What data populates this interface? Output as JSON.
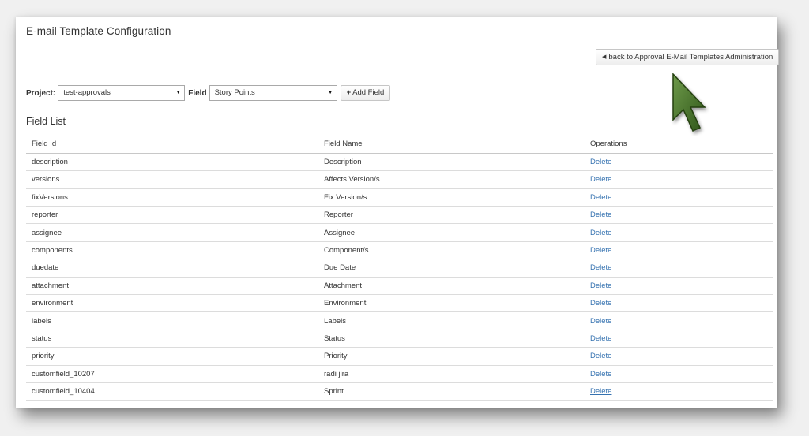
{
  "page": {
    "title": "E-mail Template Configuration"
  },
  "back_button": {
    "label": "back to Approval E-Mail Templates Administration"
  },
  "toolbar": {
    "project_label": "Project:",
    "project_value": "test-approvals",
    "field_label": "Field",
    "field_value": "Story Points",
    "add_button": "Add Field"
  },
  "field_list": {
    "title": "Field List",
    "headers": {
      "id": "Field Id",
      "name": "Field Name",
      "ops": "Operations"
    },
    "rows": [
      {
        "id": "description",
        "name": "Description",
        "op": "Delete"
      },
      {
        "id": "versions",
        "name": "Affects Version/s",
        "op": "Delete"
      },
      {
        "id": "fixVersions",
        "name": "Fix Version/s",
        "op": "Delete"
      },
      {
        "id": "reporter",
        "name": "Reporter",
        "op": "Delete"
      },
      {
        "id": "assignee",
        "name": "Assignee",
        "op": "Delete"
      },
      {
        "id": "components",
        "name": "Component/s",
        "op": "Delete"
      },
      {
        "id": "duedate",
        "name": "Due Date",
        "op": "Delete"
      },
      {
        "id": "attachment",
        "name": "Attachment",
        "op": "Delete"
      },
      {
        "id": "environment",
        "name": "Environment",
        "op": "Delete"
      },
      {
        "id": "labels",
        "name": "Labels",
        "op": "Delete"
      },
      {
        "id": "status",
        "name": "Status",
        "op": "Delete"
      },
      {
        "id": "priority",
        "name": "Priority",
        "op": "Delete"
      },
      {
        "id": "customfield_10207",
        "name": "radi jira",
        "op": "Delete"
      },
      {
        "id": "customfield_10404",
        "name": "Sprint",
        "op": "Delete"
      }
    ]
  },
  "colors": {
    "link": "#3572b0",
    "cursor": "#3f6b25"
  },
  "icons": {
    "back": "caret-left-icon",
    "add": "plus-icon",
    "cursor": "mouse-pointer-icon"
  }
}
